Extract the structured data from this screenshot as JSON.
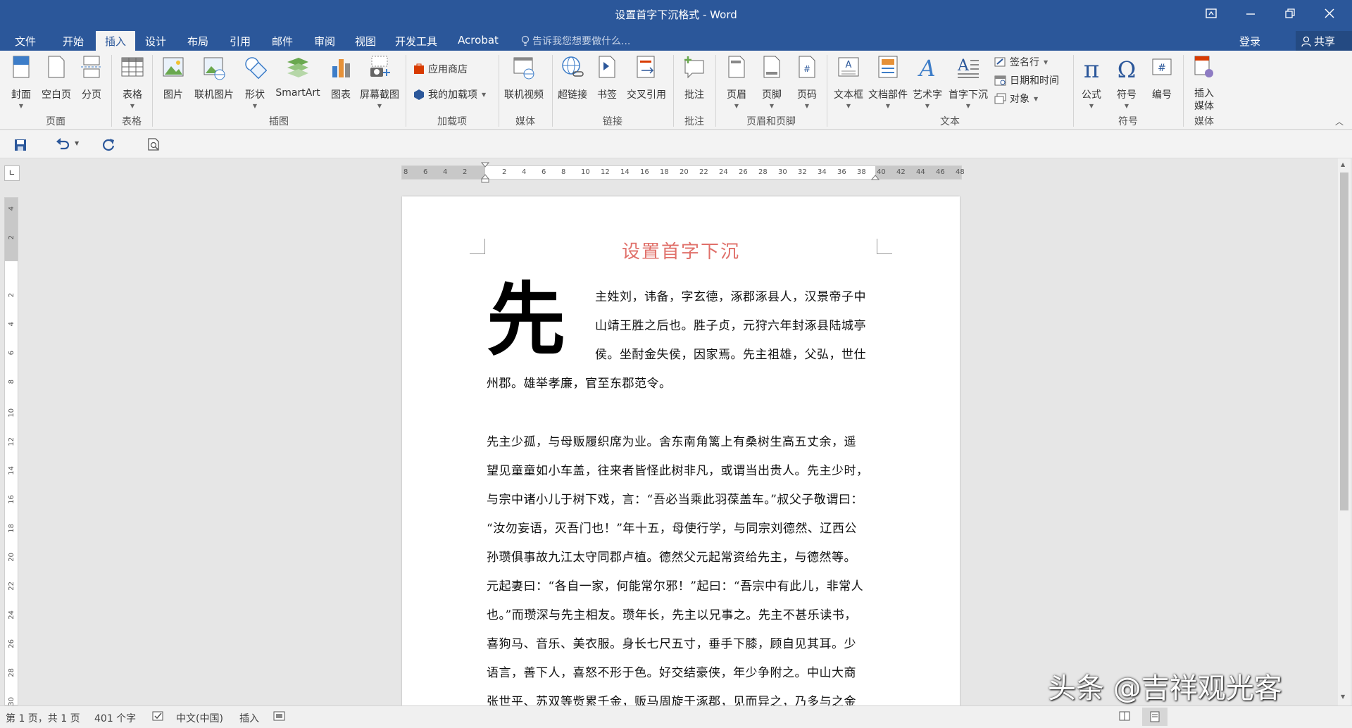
{
  "window": {
    "title": "设置首字下沉格式 - Word",
    "controls": [
      "⧉",
      "—",
      "❐",
      "✕"
    ]
  },
  "tabs": [
    "文件",
    "开始",
    "插入",
    "设计",
    "布局",
    "引用",
    "邮件",
    "审阅",
    "视图",
    "开发工具",
    "Acrobat"
  ],
  "active_tab": "插入",
  "tell_me": "告诉我您想要做什么...",
  "login": "登录",
  "share": "共享",
  "ribbon": {
    "groups": {
      "pages": "页面",
      "tables": "表格",
      "illustrations": "插图",
      "addins": "加载项",
      "media": "媒体",
      "links": "链接",
      "comments": "批注",
      "header_footer": "页眉和页脚",
      "text": "文本",
      "symbols": "符号",
      "media2": "媒体"
    },
    "buttons": {
      "cover": "封面",
      "blank": "空白页",
      "pagebreak": "分页",
      "table": "表格",
      "picture": "图片",
      "online_picture": "联机图片",
      "shapes": "形状",
      "smartart": "SmartArt",
      "chart": "图表",
      "screenshot": "屏幕截图",
      "store": "应用商店",
      "my_addins": "我的加载项",
      "online_video": "联机视频",
      "hyperlink": "超链接",
      "bookmark": "书签",
      "crossref": "交叉引用",
      "comment": "批注",
      "header": "页眉",
      "footer": "页脚",
      "pagenum": "页码",
      "textbox": "文本框",
      "quickparts": "文档部件",
      "wordart": "艺术字",
      "dropcap": "首字下沉",
      "signature": "签名行",
      "datetime": "日期和时间",
      "object": "对象",
      "equation": "公式",
      "symbol": "符号",
      "number": "编号",
      "insert_media": "插入\n媒体"
    }
  },
  "ruler": {
    "h_ticks": [
      "8",
      "6",
      "4",
      "2",
      "",
      "2",
      "4",
      "6",
      "8",
      "10",
      "12",
      "14",
      "16",
      "18",
      "20",
      "22",
      "24",
      "26",
      "28",
      "30",
      "32",
      "34",
      "36",
      "38",
      "40",
      "42",
      "44",
      "46",
      "48"
    ],
    "v_ticks": [
      "4",
      "2",
      "",
      "2",
      "4",
      "6",
      "8",
      "10",
      "12",
      "14",
      "16",
      "18",
      "20",
      "22",
      "24",
      "26",
      "28",
      "30"
    ]
  },
  "document": {
    "title": "设置首字下沉",
    "dropcap": "先",
    "para1": [
      "主姓刘，讳备，字玄德，涿郡涿县人，汉景帝子中",
      "山靖王胜之后也。胜子贞，元狩六年封涿县陆城亭",
      "侯。坐酎金失侯，因家焉。先主祖雄，父弘，世仕",
      "州郡。雄举孝廉，官至东郡范令。"
    ],
    "para2": [
      "先主少孤，与母贩履织席为业。舍东南角篱上有桑树生高五丈余，遥",
      "望见童童如小车盖，往来者皆怪此树非凡，或谓当出贵人。先主少时，",
      "与宗中诸小儿于树下戏，言：“吾必当乘此羽葆盖车。”叔父子敬谓曰：",
      "“汝勿妄语，灭吾门也！”年十五，母使行学，与同宗刘德然、辽西公",
      "孙瓒俱事故九江太守同郡卢植。德然父元起常资给先主，与德然等。",
      "元起妻曰：“各自一家，何能常尔邪！”起曰：“吾宗中有此儿，非常人",
      "也。”而瓒深与先主相友。瓒年长，先主以兄事之。先主不甚乐读书，",
      "喜狗马、音乐、美衣服。身长七尺五寸，垂手下膝，顾自见其耳。少",
      "语言，善下人，喜怒不形于色。好交结豪侠，年少争附之。中山大商",
      "张世平、苏双等赀累千金，贩马周旋于涿郡，见而异之，乃多与之金"
    ]
  },
  "status": {
    "page": "第 1 页，共 1 页",
    "words": "401 个字",
    "language": "中文(中国)",
    "mode": "插入"
  },
  "watermark": "头条 @吉祥观光客",
  "colors": {
    "titlebar": "#2b579a",
    "title_text": "#e0706a"
  }
}
